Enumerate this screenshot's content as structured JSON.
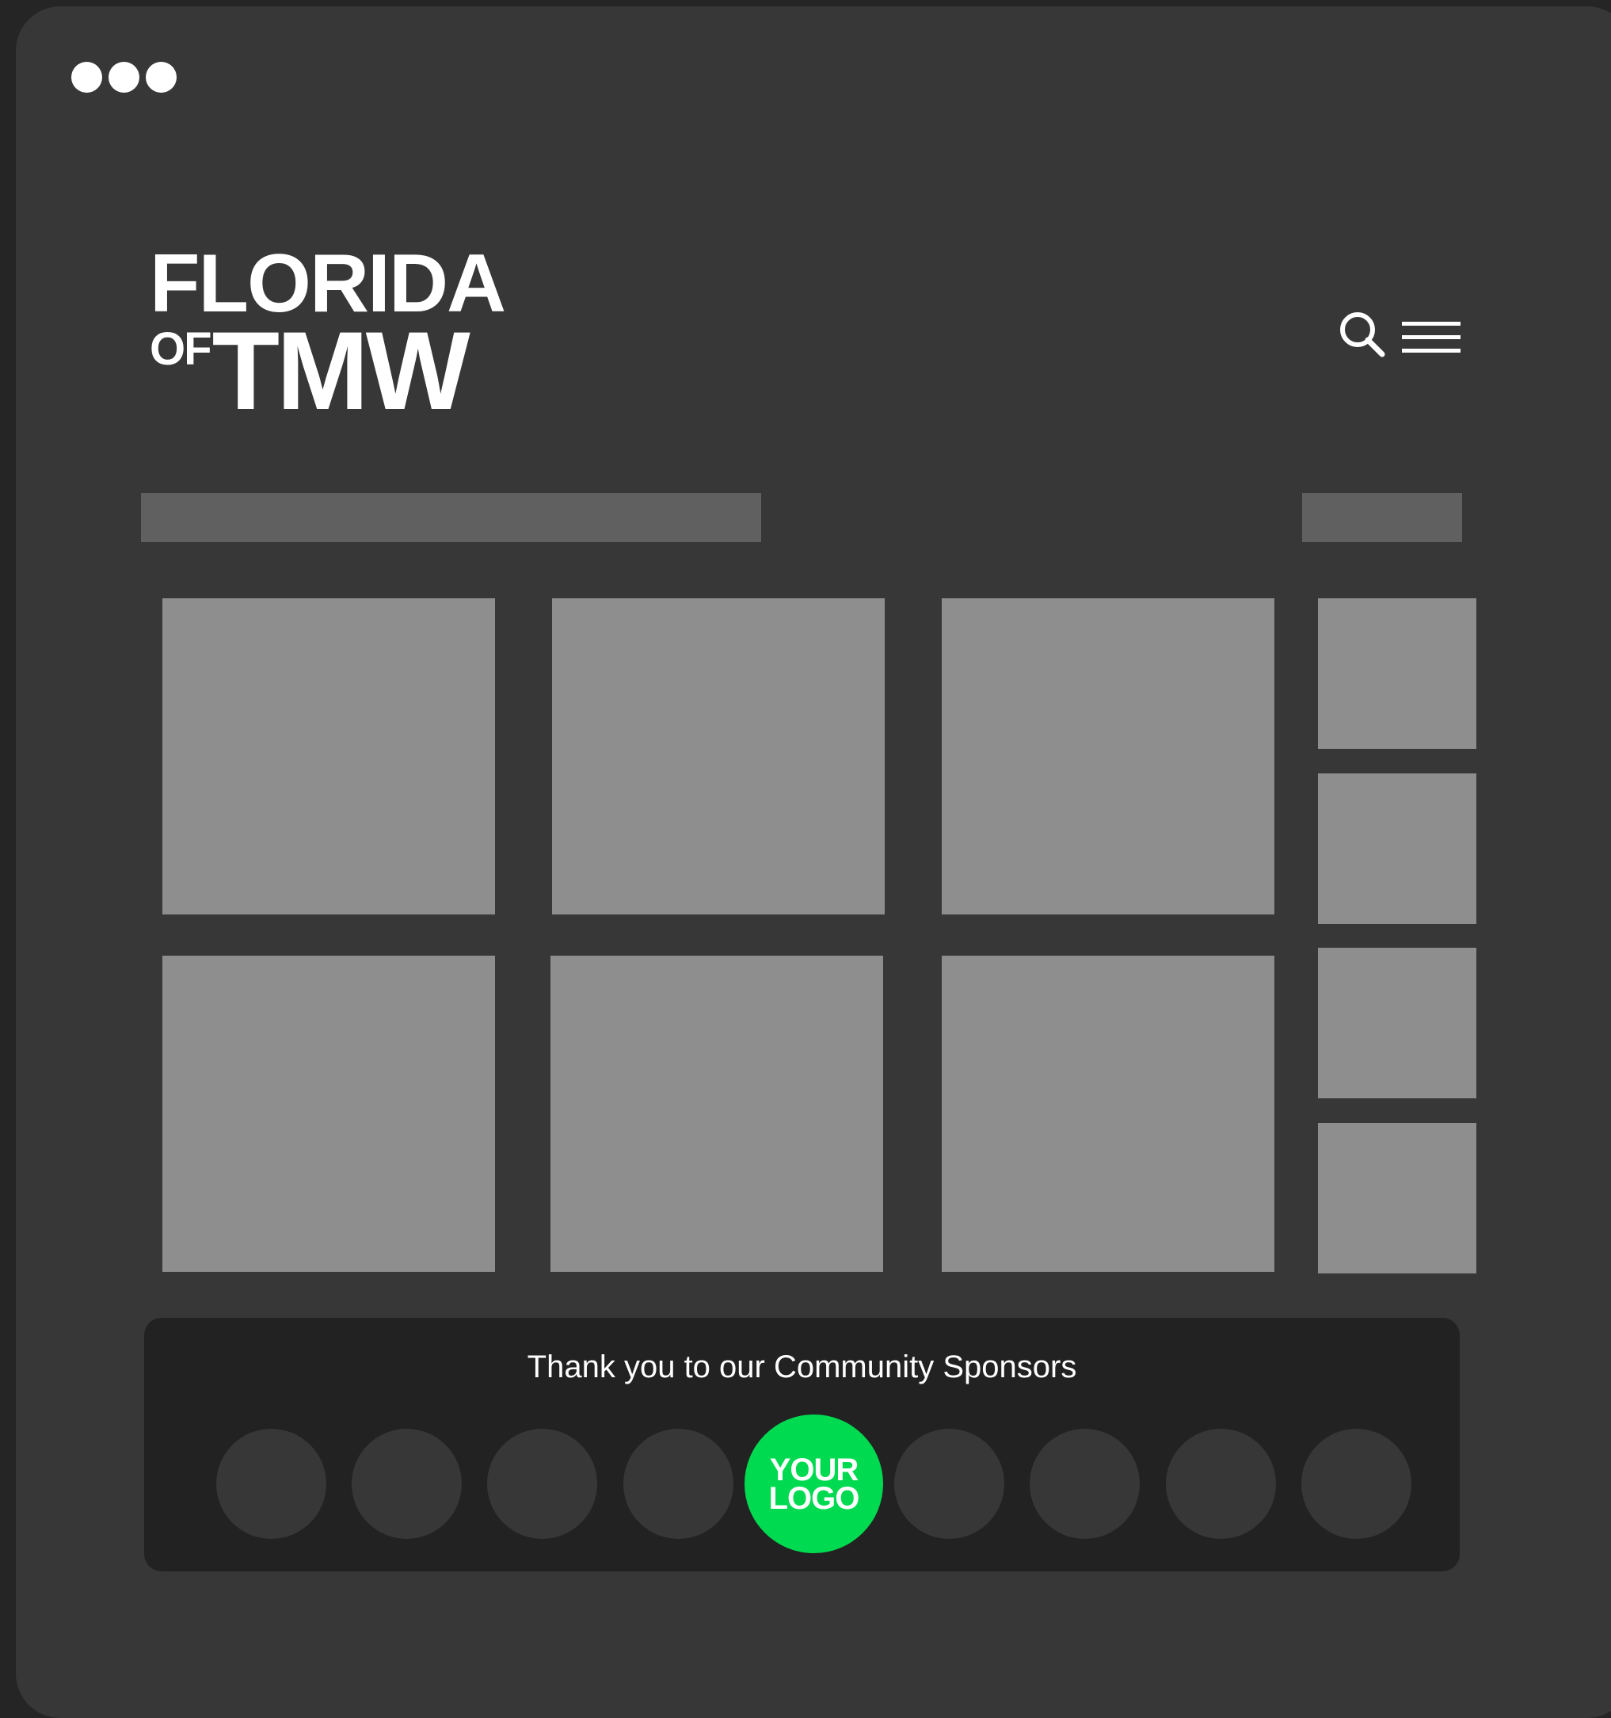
{
  "window": {
    "controls": [
      "dot",
      "dot",
      "dot"
    ]
  },
  "header": {
    "logo_line1": "FLORIDA",
    "logo_of": "OF",
    "logo_tmw": "TMW",
    "search_icon": "search-icon",
    "menu_icon": "hamburger-menu-icon"
  },
  "colors": {
    "window_bg": "#373737",
    "tile": "#8e8e8e",
    "bar": "#606060",
    "sponsor_panel": "#222222",
    "sponsor_circle": "#373737",
    "accent_green": "#00da50"
  },
  "sponsors": {
    "title": "Thank you to our Community Sponsors",
    "your_logo_line1": "YOUR",
    "your_logo_line2": "LOGO"
  }
}
